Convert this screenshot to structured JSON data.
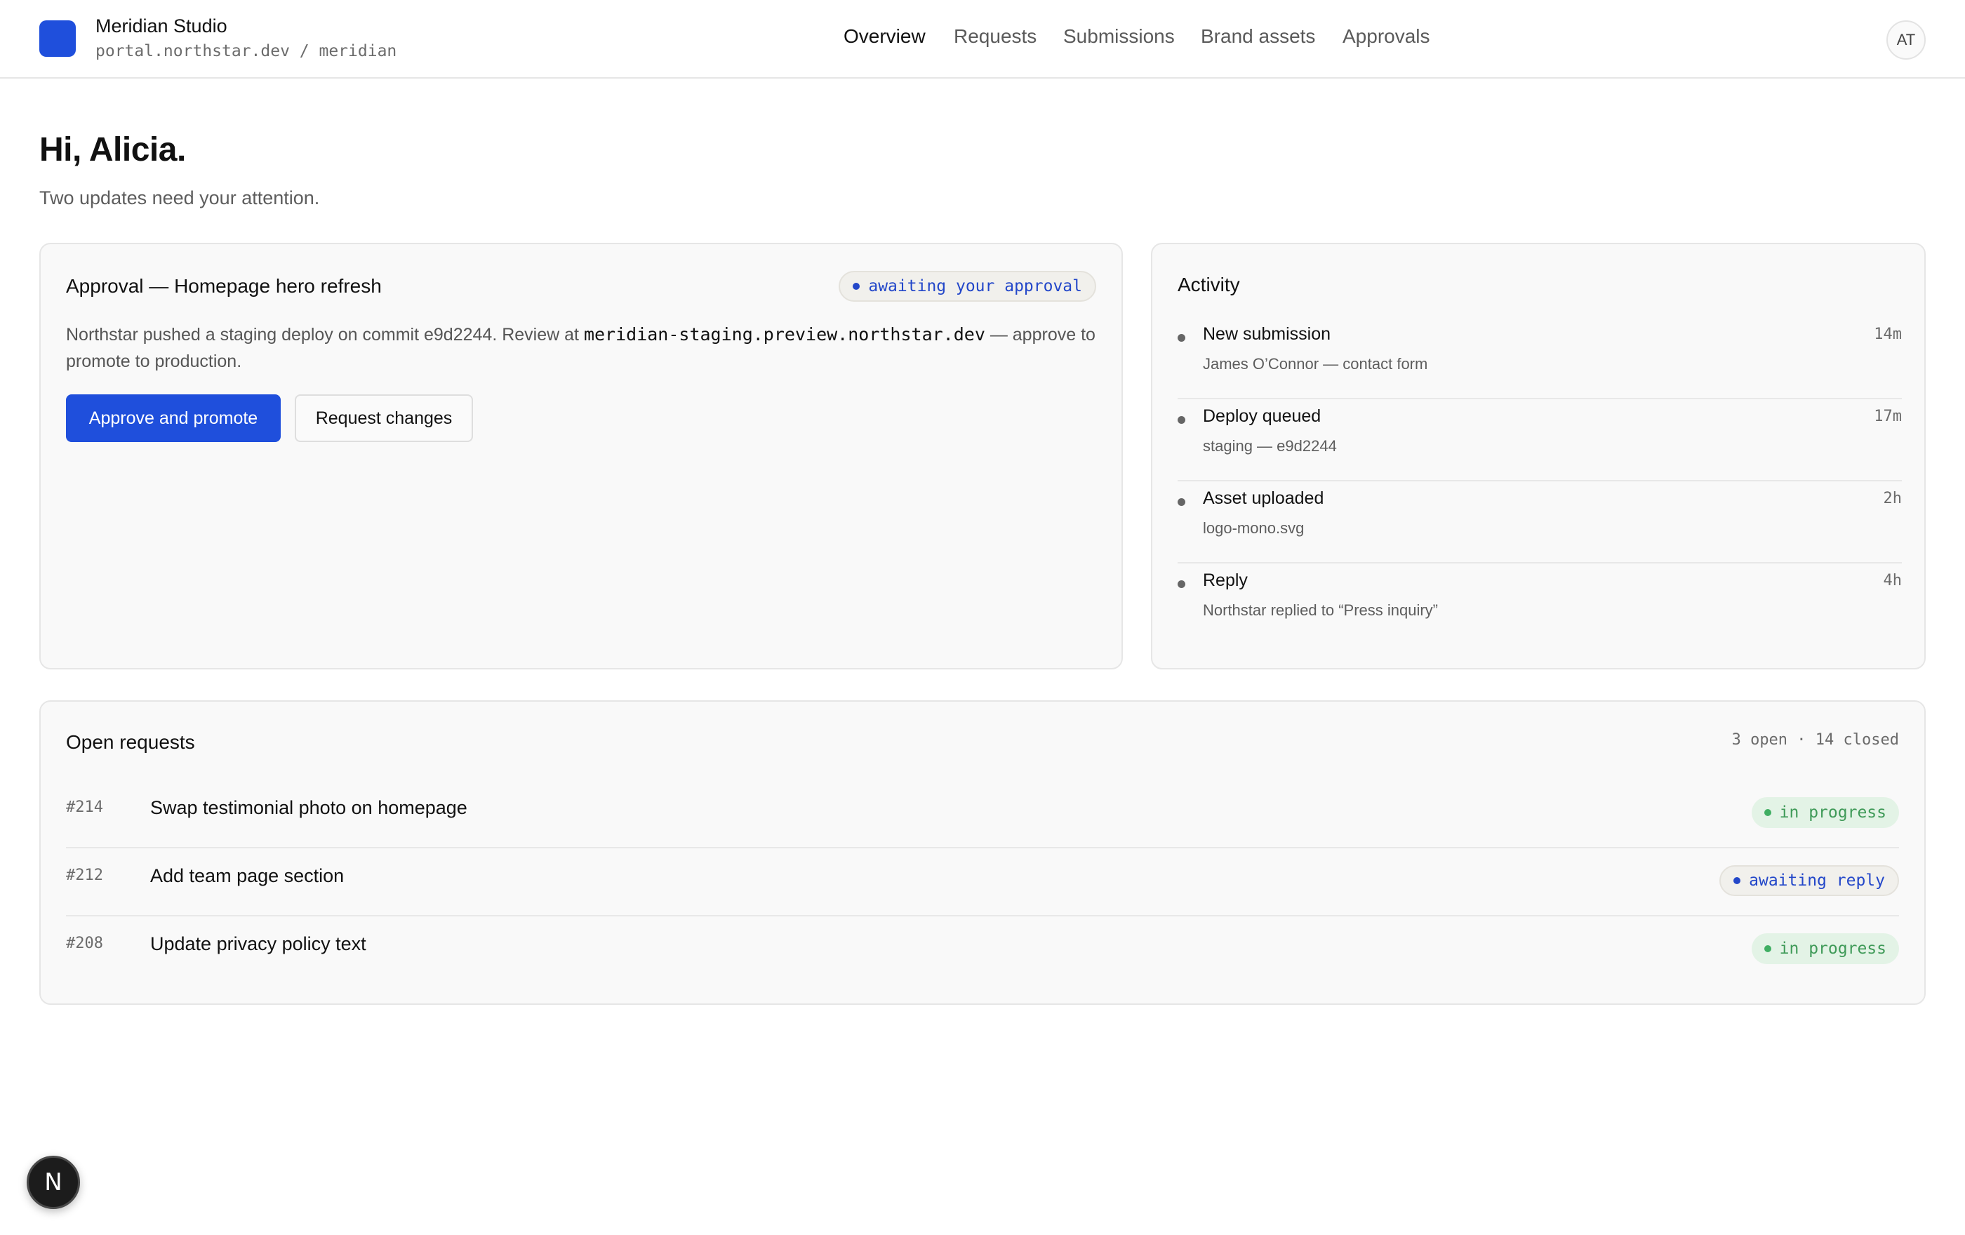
{
  "header": {
    "brand_name": "Meridian Studio",
    "brand_path": "portal.northstar.dev / meridian",
    "brand_color": "#1f4fdc",
    "nav": [
      {
        "label": "Overview",
        "active": true
      },
      {
        "label": "Requests",
        "active": false
      },
      {
        "label": "Submissions",
        "active": false
      },
      {
        "label": "Brand assets",
        "active": false
      },
      {
        "label": "Approvals",
        "active": false
      }
    ],
    "avatar_initials": "AT"
  },
  "greeting": {
    "title": "Hi, Alicia.",
    "subtitle": "Two updates need your attention."
  },
  "approval": {
    "title": "Approval — Homepage hero refresh",
    "status": "awaiting your approval",
    "desc_before": "Northstar pushed a staging deploy on commit e9d2244. Review at ",
    "desc_url": "meridian-staging.preview.northstar.dev",
    "desc_after": " — approve to promote to production.",
    "primary_button": "Approve and promote",
    "secondary_button": "Request changes"
  },
  "activity": {
    "title": "Activity",
    "items": [
      {
        "title": "New submission",
        "sub": "James O’Connor — contact form",
        "time": "14m"
      },
      {
        "title": "Deploy queued",
        "sub": "staging — e9d2244",
        "time": "17m"
      },
      {
        "title": "Asset uploaded",
        "sub": "logo-mono.svg",
        "time": "2h"
      },
      {
        "title": "Reply",
        "sub": "Northstar replied to “Press inquiry”",
        "time": "4h"
      }
    ]
  },
  "requests": {
    "title": "Open requests",
    "meta": "3 open · 14 closed",
    "rows": [
      {
        "id": "#214",
        "title": "Swap testimonial photo on homepage",
        "status": "in progress",
        "status_kind": "progress"
      },
      {
        "id": "#212",
        "title": "Add team page section",
        "status": "awaiting reply",
        "status_kind": "reply"
      },
      {
        "id": "#208",
        "title": "Update privacy policy text",
        "status": "in progress",
        "status_kind": "progress"
      }
    ]
  },
  "dev_badge": {
    "letter": "N",
    "icon": "nextjs-icon"
  }
}
